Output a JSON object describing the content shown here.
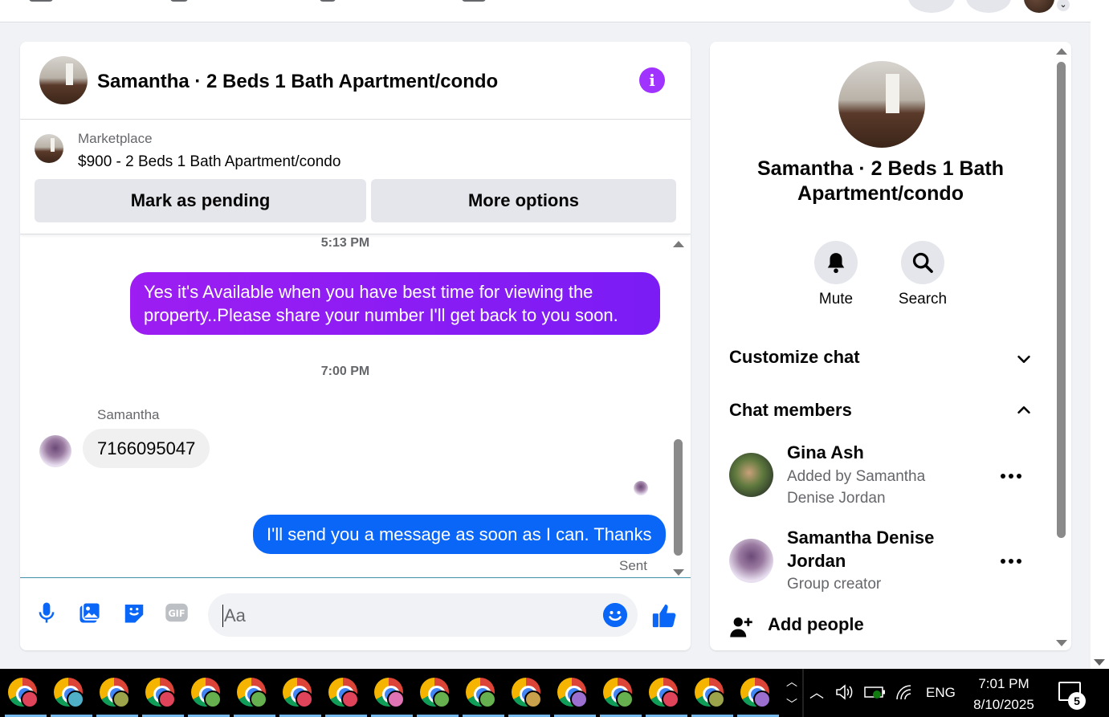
{
  "chat": {
    "title": "Samantha · 2 Beds 1 Bath Apartment/condo",
    "listing": {
      "source": "Marketplace",
      "title": "$900 - 2 Beds 1 Bath Apartment/condo",
      "mark_pending_label": "Mark as pending",
      "more_options_label": "More options"
    },
    "messages": {
      "timestamp_1": "5:13 PM",
      "outgoing_1": "Yes it's Available when you have best time for viewing the property..Please share your number I'll get back to you soon.",
      "timestamp_2": "7:00 PM",
      "sender_name": "Samantha",
      "incoming_1": "7166095047",
      "outgoing_2": "I'll send you a message as soon as I can. Thanks",
      "status": "Sent"
    },
    "composer": {
      "placeholder": "Aa",
      "icons": [
        "microphone-icon",
        "photo-icon",
        "sticker-icon",
        "gif-icon",
        "emoji-icon",
        "thumbs-up-icon"
      ]
    }
  },
  "info_panel": {
    "title": "Samantha · 2 Beds 1 Bath Apartment/condo",
    "actions": [
      {
        "label": "Mute",
        "icon": "bell-icon"
      },
      {
        "label": "Search",
        "icon": "search-icon"
      }
    ],
    "sections": {
      "customize_chat": "Customize chat",
      "chat_members": "Chat members"
    },
    "members": [
      {
        "name": "Gina Ash",
        "subtitle": "Added by Samantha Denise Jordan"
      },
      {
        "name": "Samantha Denise Jordan",
        "subtitle": "Group creator"
      }
    ],
    "add_people": "Add people"
  },
  "taskbar": {
    "language": "ENG",
    "time": "7:01 PM",
    "date": "8/10/2025",
    "notification_count": "5",
    "app_profile_colors": [
      "#e0445a",
      "#4fb0c8",
      "#9ba34b",
      "#e0445a",
      "#66b04f",
      "#66b04f",
      "#e0445a",
      "#e0445a",
      "#e073b4",
      "#66b04f",
      "#66b04f",
      "#c9a04b",
      "#9a6fd0",
      "#66b04f",
      "#e0445a",
      "#9ba34b",
      "#9a6fd0"
    ]
  },
  "colors": {
    "messenger_purple": "#a033ff",
    "outgoing_blue": "#0a66f7",
    "button_grey": "#e4e6eb"
  }
}
